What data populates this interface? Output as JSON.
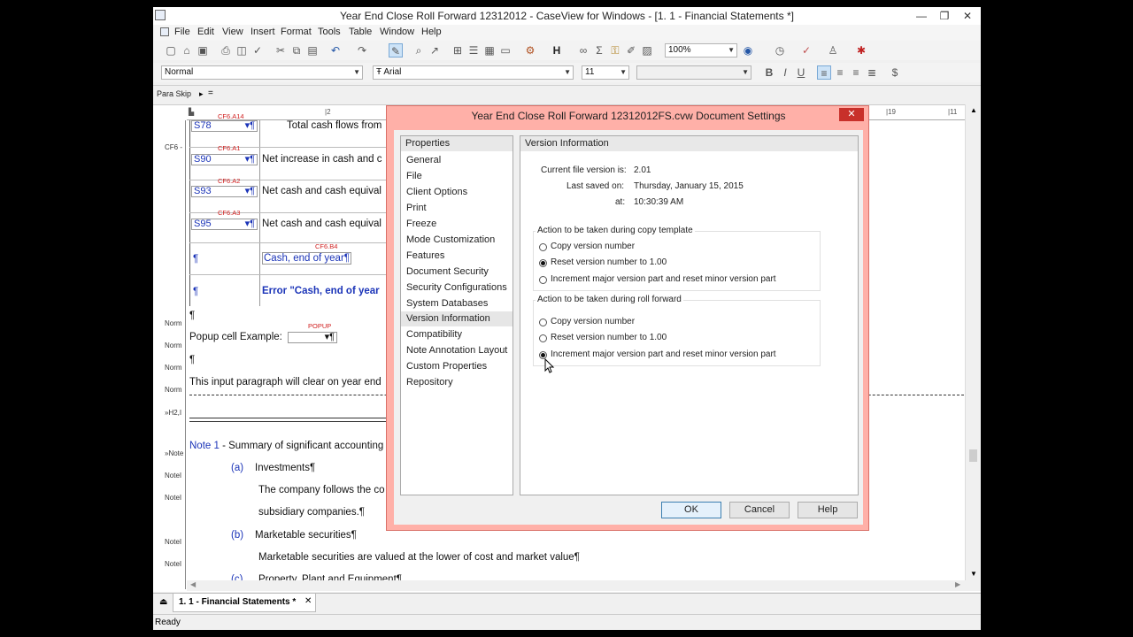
{
  "window": {
    "title": "Year End Close Roll Forward 12312012 - CaseView for Windows - [1. 1 - Financial Statements *]",
    "minimize": "—",
    "restore": "❐",
    "close": "✕"
  },
  "menu": [
    "File",
    "Edit",
    "View",
    "Insert",
    "Format",
    "Tools",
    "Table",
    "Window",
    "Help"
  ],
  "format_bar": {
    "style": "Normal",
    "font": "Arial",
    "size": "11",
    "zoom": "100%",
    "bold": "B",
    "italic": "I",
    "underline": "U"
  },
  "para_skip": "Para Skip",
  "style_labels": [
    "CF6 -",
    "Norm",
    "Norm",
    "Norm",
    "Norm",
    "»H2,I",
    "»Note",
    "NoteI",
    "NoteI",
    "NoteI",
    "NoteI"
  ],
  "document": {
    "rows": [
      {
        "tag": "CF6.A14",
        "code": "S78",
        "text": "Total cash flows from"
      },
      {
        "tag": "CF6.A1",
        "code": "S90",
        "text": "Net increase in cash and c"
      },
      {
        "tag": "CF6.A2",
        "code": "S93",
        "text": "Net cash and cash equival"
      },
      {
        "tag": "CF6.A3",
        "code": "S95",
        "text": "Net cash and cash equival"
      }
    ],
    "cash_tag": "CF6.B4",
    "cash_end": "Cash, end of year¶",
    "error_text": "Error \"Cash, end of year",
    "pilcrow": "¶",
    "popup_tag": "POPUP",
    "popup_label": "Popup cell Example:",
    "input_para": "This input paragraph will clear on year end",
    "note_prefix": "Note 1",
    "note_title": " - Summary of significant accounting",
    "items": [
      {
        "letter": "(a)",
        "text": "Investments¶"
      },
      {
        "letter": "(b)",
        "text": "Marketable securities¶"
      },
      {
        "letter": "(c)",
        "text": "Property, Plant and Equipment¶"
      }
    ],
    "company_text": "The company follows the co",
    "subsidiary_text": "subsidiary companies.¶",
    "marketable_text": "Marketable securities are valued at the lower of cost and market value¶"
  },
  "tab": {
    "label": "1. 1 - Financial Statements *",
    "close": "✕"
  },
  "status": "Ready",
  "dialog": {
    "title": "Year End Close Roll Forward 12312012FS.cvw Document Settings",
    "close": "✕",
    "properties_header": "Properties",
    "properties": [
      "General",
      "File",
      "Client Options",
      "Print",
      "Freeze",
      "Mode Customization",
      "Features",
      "Document Security",
      "Security Configurations",
      "System Databases",
      "Version Information",
      "Compatibility",
      "Note Annotation Layout",
      "Custom Properties",
      "Repository"
    ],
    "selected_property": "Version Information",
    "panel_header": "Version Information",
    "current_version_label": "Current file version is:",
    "current_version": "2.01",
    "last_saved_label": "Last saved on:",
    "last_saved_date": "Thursday, January 15, 2015",
    "at_label": "at:",
    "last_saved_time": "10:30:39 AM",
    "copy_group_label": "Action to be taken during copy template",
    "copy_options": [
      "Copy version number",
      "Reset version number to 1.00",
      "Increment major version part and reset minor version part"
    ],
    "copy_selected": 1,
    "roll_group_label": "Action to be taken during roll forward",
    "roll_options": [
      "Copy version number",
      "Reset version number to 1.00",
      "Increment major version part and reset minor version part"
    ],
    "roll_selected": 2,
    "ok": "OK",
    "cancel": "Cancel",
    "help": "Help"
  }
}
